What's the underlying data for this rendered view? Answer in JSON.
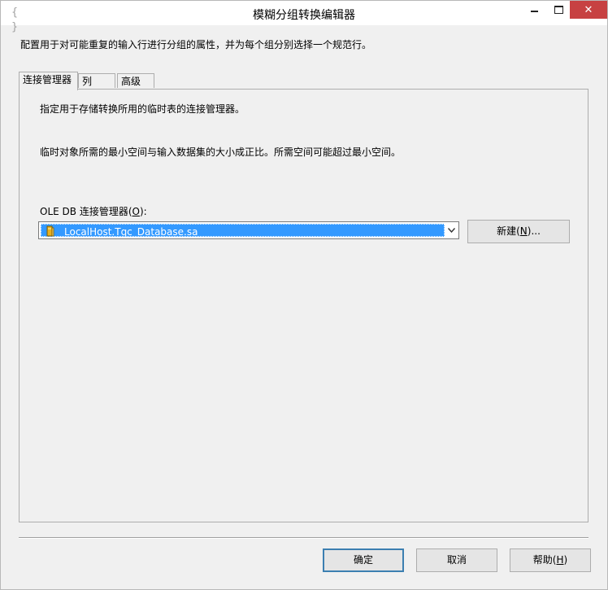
{
  "window": {
    "title": "模糊分组转换编辑器",
    "app_icon": "{ }",
    "close_glyph": "✕",
    "colors": {
      "close_button": "#c74142",
      "selection": "#3399ff",
      "background": "#f0f0f0"
    }
  },
  "description": "配置用于对可能重复的输入行进行分组的属性，并为每个组分别选择一个规范行。",
  "tabs": [
    {
      "label": "连接管理器",
      "active": true
    },
    {
      "label": "列",
      "active": false
    },
    {
      "label": "高级",
      "active": false
    }
  ],
  "panel": {
    "info1": "指定用于存储转换所用的临时表的连接管理器。",
    "info2": "临时对象所需的最小空间与输入数据集的大小成正比。所需空间可能超过最小空间。",
    "cm_label": {
      "prefix": "OLE DB 连接管理器(",
      "mnemonic": "O",
      "suffix": "):"
    },
    "connection_combo": {
      "value": "LocalHost.Tqc_Database.sa",
      "icon": "database-connection-icon"
    },
    "new_button": {
      "prefix": "新建(",
      "mnemonic": "N",
      "suffix": ")..."
    }
  },
  "footer": {
    "ok_label": "确定",
    "cancel_label": "取消",
    "help": {
      "prefix": "帮助(",
      "mnemonic": "H",
      "suffix": ")"
    }
  }
}
